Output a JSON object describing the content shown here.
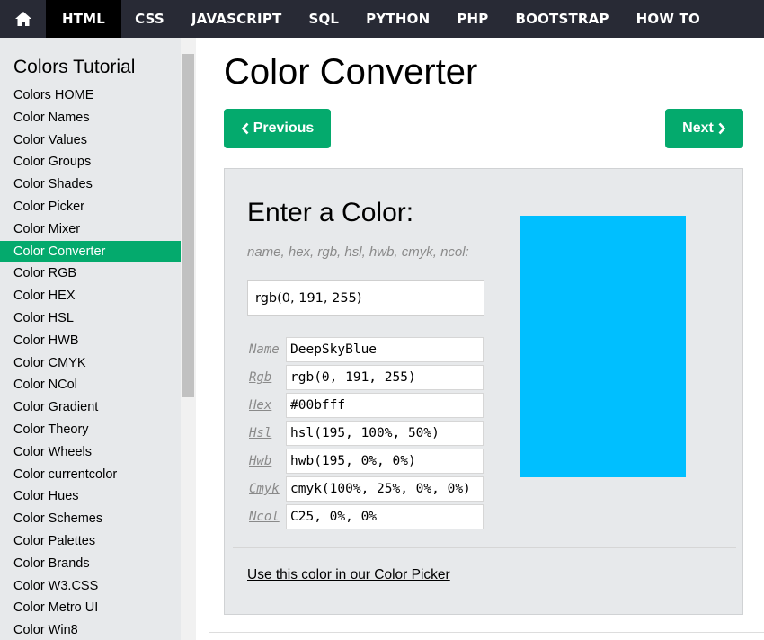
{
  "nav": {
    "home_icon": "home-icon",
    "items": [
      "HTML",
      "CSS",
      "JAVASCRIPT",
      "SQL",
      "PYTHON",
      "PHP",
      "BOOTSTRAP",
      "HOW TO"
    ],
    "active_index": 0
  },
  "sidebar": {
    "title": "Colors Tutorial",
    "items": [
      "Colors HOME",
      "Color Names",
      "Color Values",
      "Color Groups",
      "Color Shades",
      "Color Picker",
      "Color Mixer",
      "Color Converter",
      "Color RGB",
      "Color HEX",
      "Color HSL",
      "Color HWB",
      "Color CMYK",
      "Color NCol",
      "Color Gradient",
      "Color Theory",
      "Color Wheels",
      "Color currentcolor",
      "Color Hues",
      "Color Schemes",
      "Color Palettes",
      "Color Brands",
      "Color W3.CSS",
      "Color Metro UI",
      "Color Win8"
    ],
    "active_index": 7
  },
  "main": {
    "title": "Color Converter",
    "prev_label": "Previous",
    "next_label": "Next",
    "converter": {
      "heading": "Enter a Color:",
      "hint": "name, hex, rgb, hsl, hwb, cmyk, ncol:",
      "input_value": "rgb(0, 191, 255)",
      "swatch_color": "#00bfff",
      "rows": [
        {
          "label": "Name",
          "value": "DeepSkyBlue",
          "link": false
        },
        {
          "label": "Rgb",
          "value": "rgb(0, 191, 255)",
          "link": true
        },
        {
          "label": "Hex",
          "value": "#00bfff",
          "link": true
        },
        {
          "label": "Hsl",
          "value": "hsl(195, 100%, 50%)",
          "link": true
        },
        {
          "label": "Hwb",
          "value": "hwb(195, 0%, 0%)",
          "link": true
        },
        {
          "label": "Cmyk",
          "value": "cmyk(100%, 25%, 0%, 0%)",
          "link": true
        },
        {
          "label": "Ncol",
          "value": "C25, 0%, 0%",
          "link": true
        }
      ],
      "picker_link": "Use this color in our Color Picker"
    }
  },
  "colors": {
    "accent": "#04aa6d",
    "nav_bg": "#282a35",
    "sidebar_bg": "#e7e9eb"
  }
}
